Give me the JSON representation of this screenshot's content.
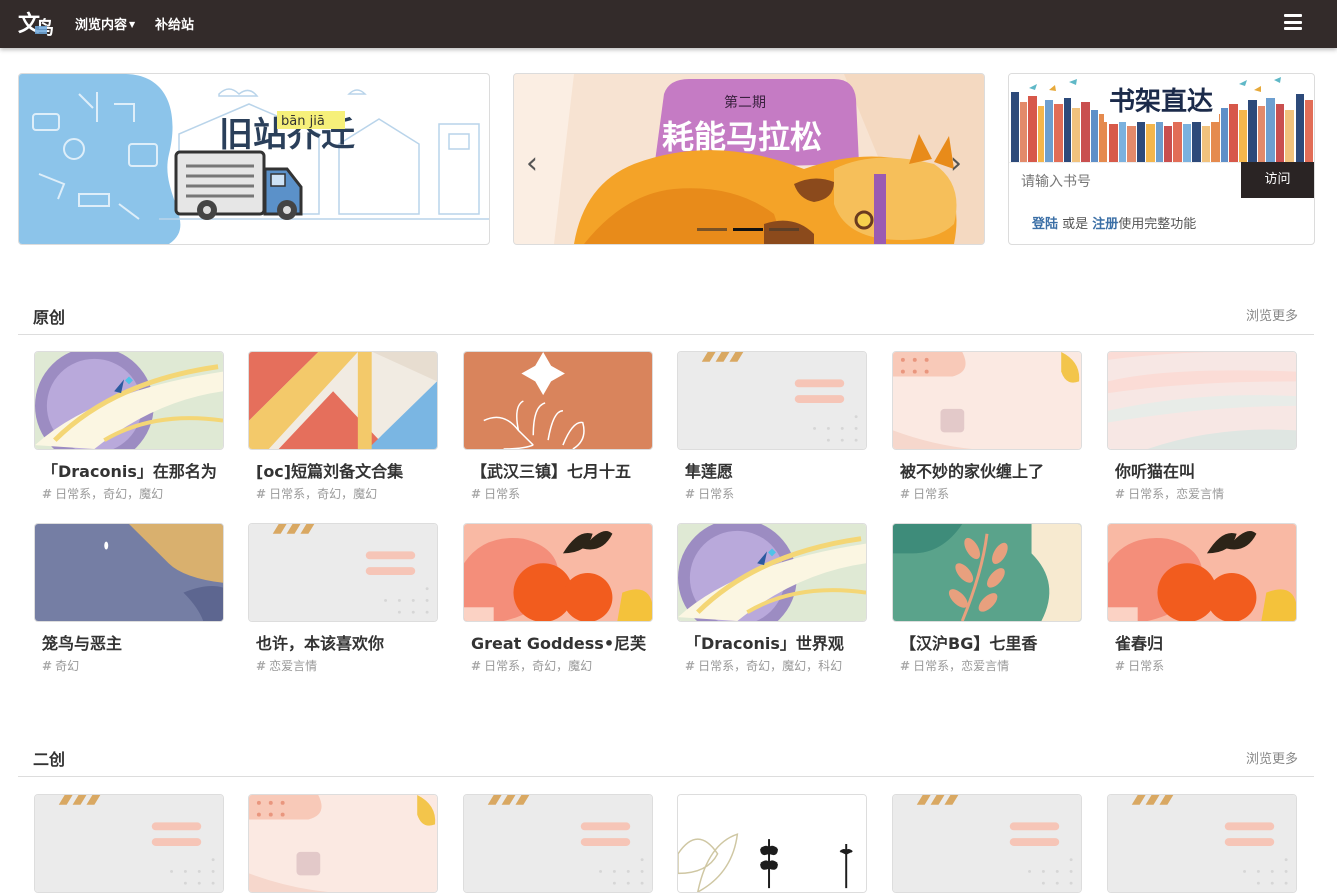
{
  "nav": {
    "logo_text": "文鸟",
    "browse": "浏览内容",
    "supply": "补给站"
  },
  "banners": {
    "move_title": "旧站乔迁",
    "move_pinyin": "bān jiā",
    "marathon_issue": "第二期",
    "marathon_title": "耗能马拉松",
    "shelf_title": "书架直达",
    "search_placeholder": "请输入书号",
    "visit_label": "访问",
    "login": "登陆",
    "or": " 或是 ",
    "register": "注册",
    "login_suffix": "使用完整功能"
  },
  "sections": [
    {
      "title": "原创",
      "more": "浏览更多",
      "items": [
        {
          "title": "「Draconis」在那名为",
          "tags": "日常系，奇幻，魔幻",
          "cover": "dragon"
        },
        {
          "title": "[oc]短篇刘备文合集",
          "tags": "日常系，奇幻，魔幻",
          "cover": "geo"
        },
        {
          "title": "【武汉三镇】七月十五",
          "tags": "日常系",
          "cover": "hand"
        },
        {
          "title": "隼莲愿",
          "tags": "日常系",
          "cover": "grey"
        },
        {
          "title": "被不妙的家伙缠上了",
          "tags": "日常系",
          "cover": "peach"
        },
        {
          "title": "你听猫在叫",
          "tags": "日常系，恋爱言情",
          "cover": "stripes"
        },
        {
          "title": "笼鸟与恶主",
          "tags": "奇幻",
          "cover": "purple"
        },
        {
          "title": "也许，本该喜欢你",
          "tags": "恋爱言情",
          "cover": "grey"
        },
        {
          "title": "Great Goddess•尼芙",
          "tags": "日常系，奇幻，魔幻",
          "cover": "floral"
        },
        {
          "title": "「Draconis」世界观",
          "tags": "日常系，奇幻，魔幻，科幻",
          "cover": "dragon"
        },
        {
          "title": "【汉沪BG】七里香",
          "tags": "日常系，恋爱言情",
          "cover": "green"
        },
        {
          "title": "雀春归",
          "tags": "日常系",
          "cover": "floral"
        }
      ]
    },
    {
      "title": "二创",
      "more": "浏览更多",
      "items": [
        {
          "cover": "grey"
        },
        {
          "cover": "peach"
        },
        {
          "cover": "grey"
        },
        {
          "cover": "leaf"
        },
        {
          "cover": "grey"
        },
        {
          "cover": "grey"
        }
      ]
    }
  ],
  "colors": {
    "nav_bg": "#332b2a",
    "link_blue": "#3b6fa6",
    "visit_btn": "#2a2424"
  }
}
